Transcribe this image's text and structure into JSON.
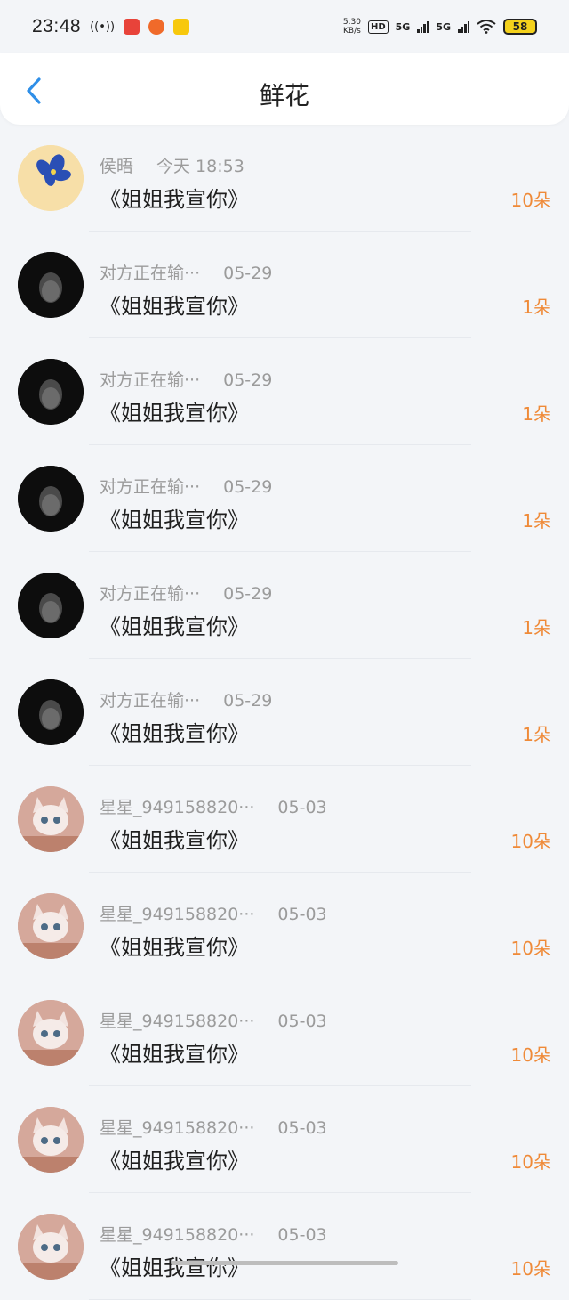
{
  "status_bar": {
    "time": "23:48",
    "net_speed": "5.30",
    "net_unit": "KB/s",
    "hd": "HD",
    "sim1": "5G",
    "sim2": "5G",
    "battery": "58"
  },
  "header": {
    "title": "鲜花"
  },
  "list": [
    {
      "name": "侯晤",
      "date": "今天 18:53",
      "message": "《姐姐我宣你》",
      "count": "10朵",
      "avatar": "flower-avatar"
    },
    {
      "name": "对方正在输···",
      "date": "05-29",
      "message": "《姐姐我宣你》",
      "count": "1朵",
      "avatar": "hood-avatar"
    },
    {
      "name": "对方正在输···",
      "date": "05-29",
      "message": "《姐姐我宣你》",
      "count": "1朵",
      "avatar": "hood-avatar"
    },
    {
      "name": "对方正在输···",
      "date": "05-29",
      "message": "《姐姐我宣你》",
      "count": "1朵",
      "avatar": "hood-avatar"
    },
    {
      "name": "对方正在输···",
      "date": "05-29",
      "message": "《姐姐我宣你》",
      "count": "1朵",
      "avatar": "hood-avatar"
    },
    {
      "name": "对方正在输···",
      "date": "05-29",
      "message": "《姐姐我宣你》",
      "count": "1朵",
      "avatar": "hood-avatar"
    },
    {
      "name": "星星_949158820···",
      "date": "05-03",
      "message": "《姐姐我宣你》",
      "count": "10朵",
      "avatar": "cat-avatar"
    },
    {
      "name": "星星_949158820···",
      "date": "05-03",
      "message": "《姐姐我宣你》",
      "count": "10朵",
      "avatar": "cat-avatar"
    },
    {
      "name": "星星_949158820···",
      "date": "05-03",
      "message": "《姐姐我宣你》",
      "count": "10朵",
      "avatar": "cat-avatar"
    },
    {
      "name": "星星_949158820···",
      "date": "05-03",
      "message": "《姐姐我宣你》",
      "count": "10朵",
      "avatar": "cat-avatar"
    },
    {
      "name": "星星_949158820···",
      "date": "05-03",
      "message": "《姐姐我宣你》",
      "count": "10朵",
      "avatar": "cat-avatar"
    }
  ],
  "colors": {
    "accent": "#2f8fe8",
    "count": "#ef8a38"
  }
}
